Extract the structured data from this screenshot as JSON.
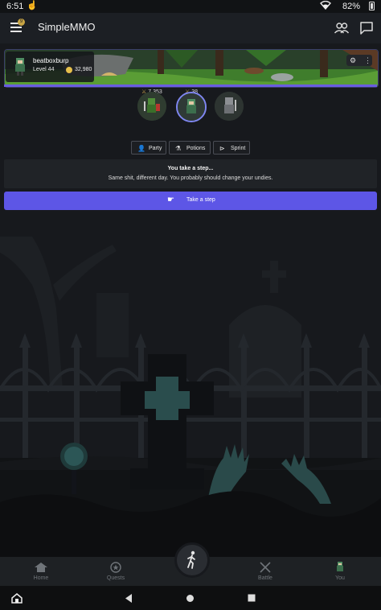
{
  "status_bar": {
    "time": "6:51",
    "battery": "82%"
  },
  "app_bar": {
    "title": "SimpleMMO",
    "menu_badge": "9"
  },
  "player": {
    "name": "beatboxburp",
    "level": "Level 44",
    "gold": "32,980"
  },
  "party": [
    {
      "stat": "7,353"
    },
    {
      "stat": "38"
    }
  ],
  "actions": {
    "party_label": "Party",
    "potions_label": "Potions",
    "sprint_label": "Sprint"
  },
  "message": {
    "title": "You take a step...",
    "body": "Same shit, different day. You probably should change your undies."
  },
  "step_button": {
    "label": "Take a step"
  },
  "bottom_nav": {
    "home": "Home",
    "quests": "Quests",
    "battle": "Battle",
    "you": "You"
  },
  "colors": {
    "accent": "#5d56e6",
    "background": "#17191d",
    "gold": "#e6c04b"
  }
}
